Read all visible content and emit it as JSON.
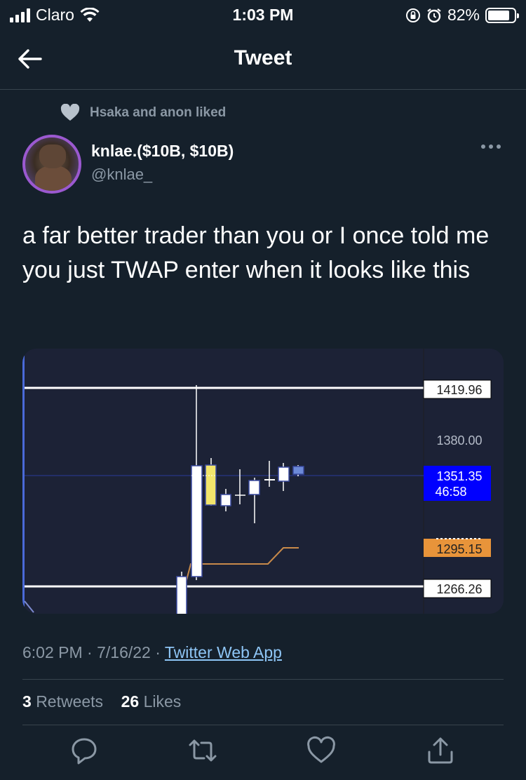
{
  "status_bar": {
    "carrier": "Claro",
    "time": "1:03 PM",
    "battery": "82%",
    "battery_level": 0.82,
    "icons": [
      "signal-icon",
      "wifi-icon",
      "rotation-lock-icon",
      "alarm-icon",
      "battery-icon"
    ]
  },
  "nav": {
    "title": "Tweet",
    "back_icon": "arrow-left-icon"
  },
  "social_context": {
    "text": "Hsaka and anon liked",
    "icon": "heart-icon"
  },
  "author": {
    "name": "knlae.($10B, $10B)",
    "handle": "@knlae_"
  },
  "tweet": {
    "text": "a far better trader than you or I once told me you just TWAP enter when it looks like this"
  },
  "chart": {
    "price_labels": [
      {
        "value": "1419.96",
        "style": "box"
      },
      {
        "value": "1380.00",
        "style": "plain"
      },
      {
        "value": "1351.35",
        "sub": "46:58",
        "style": "current"
      },
      {
        "value": "1295.15",
        "style": "orange"
      },
      {
        "value": "1266.26",
        "style": "box"
      }
    ],
    "colors": {
      "background": "#1c2236",
      "current": "#0000ff",
      "orange": "#e8943a",
      "line": "#ffffff"
    }
  },
  "meta": {
    "time": "6:02 PM",
    "date": "7/16/22",
    "separator": "·",
    "source": "Twitter Web App"
  },
  "stats": {
    "retweets_count": "3",
    "retweets_label": "Retweets",
    "likes_count": "26",
    "likes_label": "Likes"
  },
  "actions": [
    "reply-icon",
    "retweet-icon",
    "like-icon",
    "share-icon"
  ]
}
